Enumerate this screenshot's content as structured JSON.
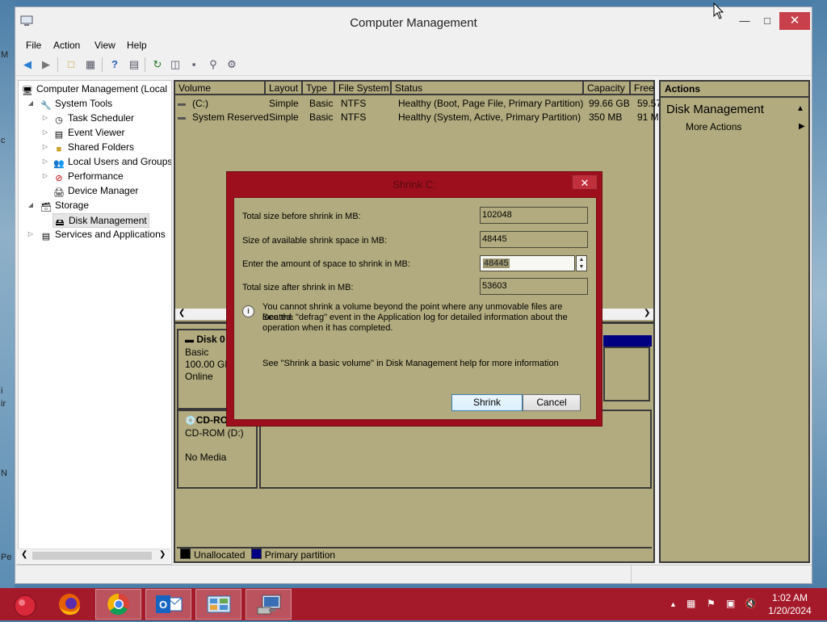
{
  "window": {
    "title": "Computer Management",
    "minimize_icon": "minimize-icon",
    "maximize_icon": "maximize-icon",
    "close_icon": "close-icon"
  },
  "menu": [
    "File",
    "Action",
    "View",
    "Help"
  ],
  "toolbar_icons": [
    "back-arrow-icon",
    "forward-arrow-icon",
    "up-folder-icon",
    "show-hide-tree-icon",
    "help-icon",
    "properties-icon",
    "refresh-icon",
    "export-list-icon",
    "connect-icon",
    "rescan-icon",
    "settings-icon"
  ],
  "tree": {
    "root": "Computer Management (Local",
    "system_tools": "System Tools",
    "task_scheduler": "Task Scheduler",
    "event_viewer": "Event Viewer",
    "shared_folders": "Shared Folders",
    "local_users": "Local Users and Groups",
    "performance": "Performance",
    "device_manager": "Device Manager",
    "storage": "Storage",
    "disk_management": "Disk Management",
    "services": "Services and Applications"
  },
  "volumes": {
    "headers": [
      "Volume",
      "Layout",
      "Type",
      "File System",
      "Status",
      "Capacity",
      "Free"
    ],
    "rows": [
      [
        "(C:)",
        "Simple",
        "Basic",
        "NTFS",
        "Healthy (Boot, Page File, Primary Partition)",
        "99.66 GB",
        "59.57"
      ],
      [
        "System Reserved",
        "Simple",
        "Basic",
        "NTFS",
        "Healthy (System, Active, Primary Partition)",
        "350 MB",
        "91 M"
      ]
    ]
  },
  "disks": {
    "disk0": {
      "name": "Disk 0",
      "type": "Basic",
      "size": "100.00 GB",
      "status": "Online"
    },
    "cdrom": {
      "name": "CD-RO",
      "label": "CD-ROM (D:)",
      "media": "No Media"
    }
  },
  "legend": {
    "unallocated": "Unallocated",
    "primary": "Primary partition",
    "unallocated_color": "#000000",
    "primary_color": "#000080"
  },
  "actions": {
    "header": "Actions",
    "section": "Disk Management",
    "more": "More Actions"
  },
  "dialog": {
    "title": "Shrink C:",
    "total_before_label": "Total size before shrink in MB:",
    "total_before_value": "102048",
    "available_label": "Size of available shrink space in MB:",
    "available_value": "48445",
    "enter_label": "Enter the amount of space to shrink in MB:",
    "enter_value": "48445",
    "total_after_label": "Total size after shrink in MB:",
    "total_after_value": "53603",
    "info_line1": "You cannot shrink a volume beyond the point where any unmovable files are located.",
    "info_line2": "See the \"defrag\" event in the Application log for detailed information about the",
    "info_line3": "operation when it has completed.",
    "help_text": "See \"Shrink a basic volume\" in Disk Management help for more information",
    "shrink_button": "Shrink",
    "cancel_button": "Cancel"
  },
  "desktop_edge_letters": [
    "M",
    "c",
    "i",
    "ir",
    "N",
    "Pe"
  ],
  "taskbar": {
    "apps": [
      "start-orb-icon",
      "firefox-icon",
      "chrome-icon",
      "outlook-icon",
      "control-panel-icon",
      "computer-management-icon"
    ],
    "time": "1:02 AM",
    "date": "1/20/2024"
  },
  "colors": {
    "taskbar": "#a41a2a",
    "panel_bg": "#b2ab7f",
    "dialog_frame": "#9e0f1e"
  }
}
